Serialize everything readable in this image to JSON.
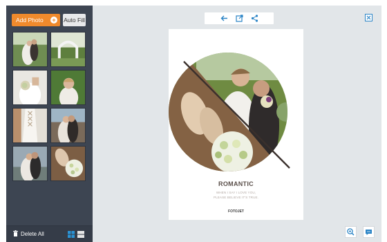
{
  "sidebar": {
    "add_photo_label": "Add Photo",
    "auto_fill_label": "Auto Fill",
    "delete_all_label": "Delete All",
    "thumbnails": [
      {
        "subject": "couple-outdoor"
      },
      {
        "subject": "wedding-arch"
      },
      {
        "subject": "bride-bouquet"
      },
      {
        "subject": "bride-portrait"
      },
      {
        "subject": "dress-lacing"
      },
      {
        "subject": "couple-kiss"
      },
      {
        "subject": "couple-embrace"
      },
      {
        "subject": "shoes-bouquet"
      }
    ]
  },
  "toolbar": {
    "icons": [
      "back-arrow-icon",
      "export-icon",
      "share-icon"
    ]
  },
  "poster": {
    "title": "ROMANTIC",
    "subtitle_line1": "WHEN I SAY I LOVE YOU,",
    "subtitle_line2": "PLEASE BELIEVE IT'S TRUE.",
    "brand": "FOTOJET"
  },
  "colors": {
    "accent": "#f08a2c",
    "sidebar": "#3d4552",
    "canvas": "#e2e6e9",
    "link": "#2a84c6"
  }
}
